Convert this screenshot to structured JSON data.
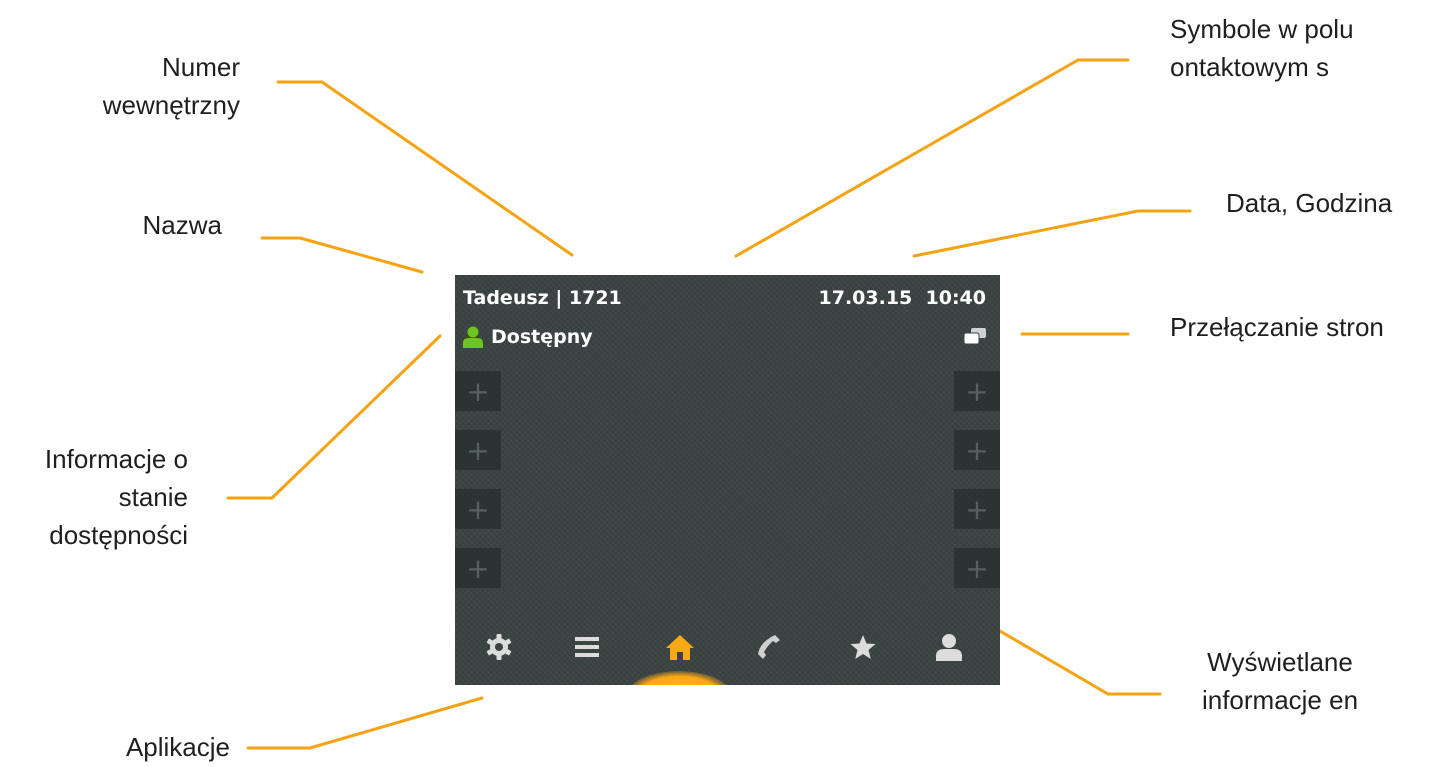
{
  "callouts": {
    "numer_wewnetrzny": "Numer\nwewnętrzny",
    "nazwa": "Nazwa",
    "informacje_o_stanie": "Informacje o\nstanie\ndostępności",
    "aplikacje": "Aplikacje",
    "symbole": "Symbole w polu\nontaktowym s",
    "data_godzina": "Data, Godzina",
    "przelaczanie": "Przełączanie stron",
    "wyswietlane": "Wyświetlane\ninformacje en"
  },
  "screen": {
    "user_name": "Tadeusz | 1721",
    "date": "17.03.15",
    "time": "10:40",
    "status": "Dostępny",
    "slot_symbol": "+",
    "apps": [
      "gear-icon",
      "menu-icon",
      "home-icon",
      "phone-icon",
      "star-icon",
      "contact-icon"
    ],
    "active_app": "home-icon"
  },
  "colors": {
    "leader": "#f5a312",
    "screen_bg": "#3b4343",
    "status_green": "#6cc51e",
    "active_icon": "#f8a913"
  }
}
